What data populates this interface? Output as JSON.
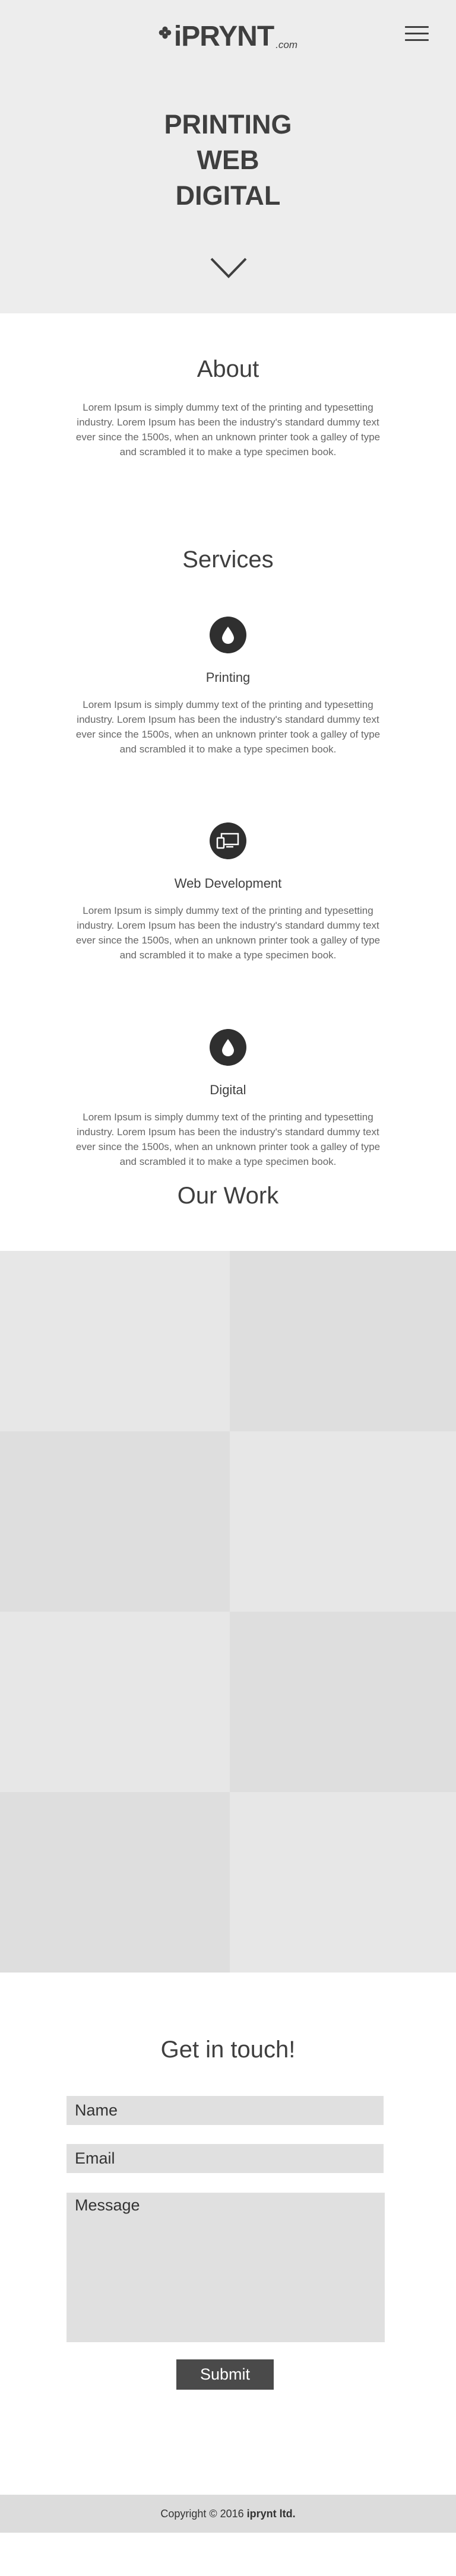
{
  "header": {
    "logo_text": "iPRYNT",
    "logo_suffix": ".com",
    "logo_icon": "clover-icon",
    "menu_icon": "hamburger-menu-icon"
  },
  "hero": {
    "lines": [
      "PRINTING",
      "WEB",
      "DIGITAL"
    ],
    "scroll_icon": "chevron-down-icon"
  },
  "about": {
    "title": "About",
    "text": "Lorem Ipsum is simply dummy text of the printing and typesetting industry. Lorem Ipsum has been the industry's standard dummy text ever since the 1500s, when an unknown printer took a galley of type and scrambled it to make a type specimen book."
  },
  "services": {
    "title": "Services",
    "items": [
      {
        "name": "Printing",
        "icon": "ink-drop-icon",
        "text": "Lorem Ipsum is simply dummy text of the printing and typesetting industry. Lorem Ipsum has been the industry's standard dummy text ever since the 1500s, when an unknown printer took a galley of type and scrambled it to make a type specimen book."
      },
      {
        "name": "Web Development",
        "icon": "devices-icon",
        "text": "Lorem Ipsum is simply dummy text of the printing and typesetting industry. Lorem Ipsum has been the industry's standard dummy text ever since the 1500s, when an unknown printer took a galley of type and scrambled it to make a type specimen book."
      },
      {
        "name": "Digital",
        "icon": "ink-drop-icon",
        "text": "Lorem Ipsum is simply dummy text of the printing and typesetting industry. Lorem Ipsum has been the industry's standard dummy text ever since the 1500s, when an unknown printer took a galley of type and scrambled it to make a type specimen book."
      }
    ]
  },
  "work": {
    "title": "Our Work",
    "tile_colors": [
      "#e7e7e7",
      "#dedede",
      "#dedede",
      "#e7e7e7",
      "#e7e7e7",
      "#dedede",
      "#dedede",
      "#e7e7e7"
    ]
  },
  "contact": {
    "title": "Get in touch!",
    "name_placeholder": "Name",
    "email_placeholder": "Email",
    "message_placeholder": "Message",
    "submit_label": "Submit"
  },
  "footer": {
    "copyright": "Copyright © 2016",
    "company": "iprynt ltd."
  }
}
